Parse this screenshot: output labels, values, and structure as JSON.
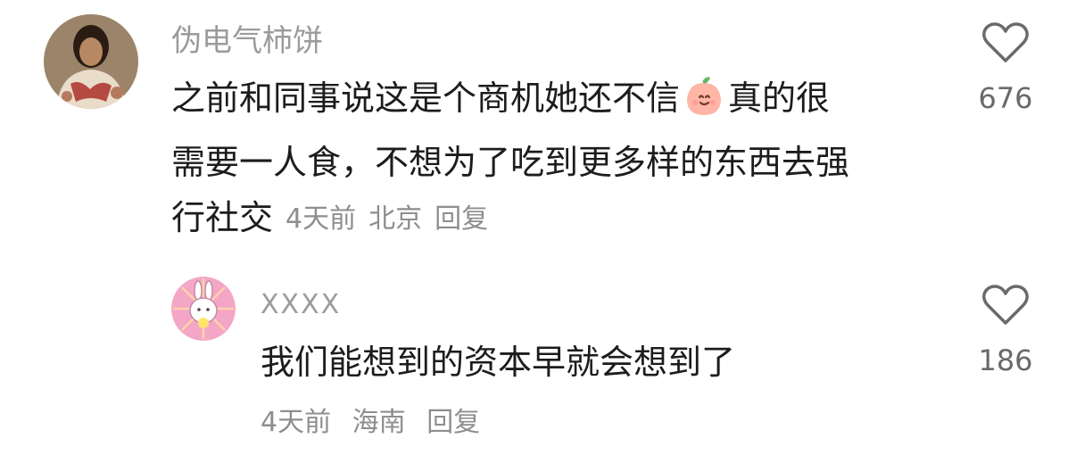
{
  "comment": {
    "username": "伪电气柿饼",
    "text_lines": [
      "之前和同事说这是个商机她还不信",
      "真的很",
      "需要一人食，不想为了吃到更多样的东西去强",
      "行社交"
    ],
    "emoji": "peach-smile-emoji",
    "time": "4天前",
    "location": "北京",
    "reply_label": "回复",
    "likes": "676"
  },
  "reply": {
    "username": "XXXX",
    "text": "我们能想到的资本早就会想到了",
    "time": "4天前",
    "location": "海南",
    "reply_label": "回复",
    "likes": "186"
  },
  "colors": {
    "username": "#9b9b9b",
    "text": "#1c1c1c",
    "meta": "#8e8e8e",
    "icon": "#6a6a6a",
    "reply_avatar_bg": "#f4a6c6"
  }
}
